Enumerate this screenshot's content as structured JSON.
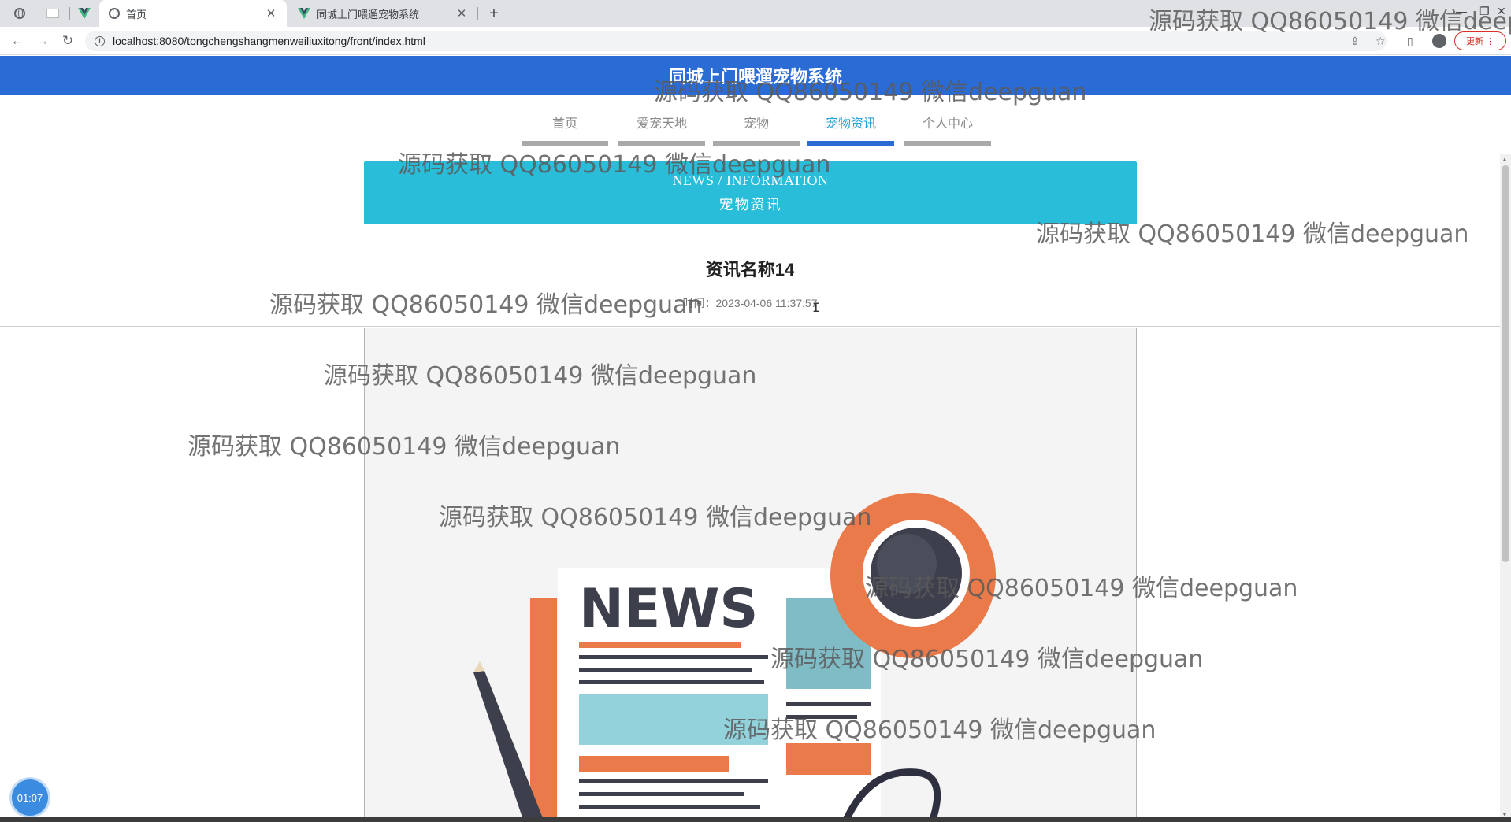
{
  "browser": {
    "tabs": [
      {
        "title": "首页",
        "active": true
      },
      {
        "title": "同城上门喂遛宠物系统",
        "active": false
      }
    ],
    "url": "localhost:8080/tongchengshangmenweiliuxitong/front/index.html",
    "update_label": "更新"
  },
  "site": {
    "title": "同城上门喂遛宠物系统",
    "nav": [
      {
        "label": "首页",
        "active": false
      },
      {
        "label": "爱宠天地",
        "active": false
      },
      {
        "label": "宠物",
        "active": false
      },
      {
        "label": "宠物资讯",
        "active": true
      },
      {
        "label": "个人中心",
        "active": false
      }
    ],
    "accent_color": "#2a6bd6",
    "banner_color": "#29bdd9"
  },
  "banner": {
    "en": "NEWS / INFORMATION",
    "zh": "宠物资讯"
  },
  "article": {
    "title": "资讯名称14",
    "time_label": "时间：",
    "time_value": "2023-04-06 11:37:57",
    "image_headline": "NEWS"
  },
  "recorder": {
    "timer": "01:07"
  },
  "watermark": {
    "text": "源码获取 QQ86050149 微信deepguan",
    "text_cut": "源码获取 QQ86050149 微信deep"
  }
}
